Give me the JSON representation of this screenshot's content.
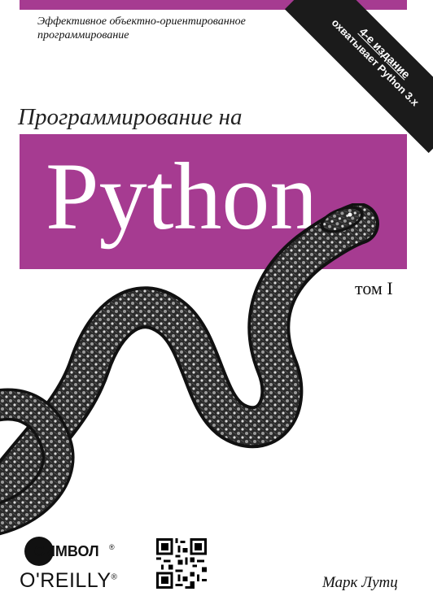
{
  "cover": {
    "series_line": "Эффективное объектно-ориентированное\nпрограммирование",
    "banner": {
      "edition": "4-е издание",
      "covers": "охватывает Python 3.x"
    },
    "subtitle": "Программирование на",
    "title": "Python",
    "volume": "том I",
    "author": "Марк Лутц",
    "publisher_1": "СИМВОЛ",
    "publisher_2": "O'REILLY",
    "registered_mark": "®",
    "colors": {
      "accent": "#a63b91",
      "banner": "#1b1b1b",
      "title_text": "#ffffff"
    },
    "icons": [
      "snake-illustration",
      "symbol-plus-logo",
      "qr-code"
    ]
  }
}
